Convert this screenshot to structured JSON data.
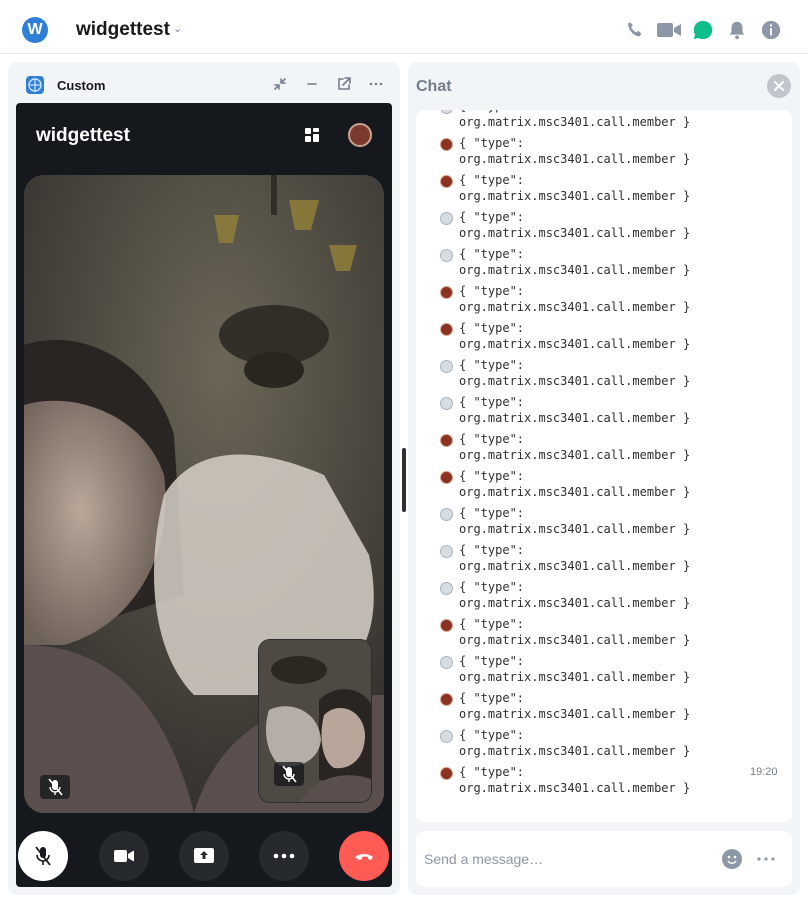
{
  "header": {
    "room_avatar_letter": "W",
    "room_name": "widgettest",
    "room_menu_icon": "chevron-down-icon",
    "icons": [
      "phone-icon",
      "video-icon",
      "threads-icon",
      "bell-icon",
      "info-icon"
    ],
    "accent": "#0dbd8b"
  },
  "widget": {
    "title": "Custom",
    "icons": [
      "widget-icon",
      "minimize-icon",
      "collapse-icon",
      "popout-icon",
      "overflow-icon"
    ]
  },
  "call": {
    "room_title": "widgettest",
    "controls": [
      "microphone-muted-icon",
      "video-icon",
      "screen-share-icon",
      "more-icon",
      "hangup-icon"
    ],
    "hangup_color": "#ff5b55"
  },
  "chat": {
    "title": "Chat",
    "messages": [
      {
        "line1": "{ \"type\":",
        "line2": "org.matrix.msc3401.call.member }",
        "sender": "b"
      },
      {
        "line1": "{ \"type\":",
        "line2": "org.matrix.msc3401.call.member }",
        "sender": "a"
      },
      {
        "line1": "{ \"type\":",
        "line2": "org.matrix.msc3401.call.member }",
        "sender": "a"
      },
      {
        "line1": "{ \"type\":",
        "line2": "org.matrix.msc3401.call.member }",
        "sender": "b"
      },
      {
        "line1": "{ \"type\":",
        "line2": "org.matrix.msc3401.call.member }",
        "sender": "b"
      },
      {
        "line1": "{ \"type\":",
        "line2": "org.matrix.msc3401.call.member }",
        "sender": "a"
      },
      {
        "line1": "{ \"type\":",
        "line2": "org.matrix.msc3401.call.member }",
        "sender": "a"
      },
      {
        "line1": "{ \"type\":",
        "line2": "org.matrix.msc3401.call.member }",
        "sender": "b"
      },
      {
        "line1": "{ \"type\":",
        "line2": "org.matrix.msc3401.call.member }",
        "sender": "b"
      },
      {
        "line1": "{ \"type\":",
        "line2": "org.matrix.msc3401.call.member }",
        "sender": "a"
      },
      {
        "line1": "{ \"type\":",
        "line2": "org.matrix.msc3401.call.member }",
        "sender": "a"
      },
      {
        "line1": "{ \"type\":",
        "line2": "org.matrix.msc3401.call.member }",
        "sender": "b"
      },
      {
        "line1": "{ \"type\":",
        "line2": "org.matrix.msc3401.call.member }",
        "sender": "b"
      },
      {
        "line1": "{ \"type\":",
        "line2": "org.matrix.msc3401.call.member }",
        "sender": "b"
      },
      {
        "line1": "{ \"type\":",
        "line2": "org.matrix.msc3401.call.member }",
        "sender": "a"
      },
      {
        "line1": "{ \"type\":",
        "line2": "org.matrix.msc3401.call.member }",
        "sender": "b"
      },
      {
        "line1": "{ \"type\":",
        "line2": "org.matrix.msc3401.call.member }",
        "sender": "a"
      },
      {
        "line1": "{ \"type\":",
        "line2": "org.matrix.msc3401.call.member }",
        "sender": "b"
      },
      {
        "line1": "{ \"type\":",
        "line2": "org.matrix.msc3401.call.member }",
        "sender": "a"
      }
    ],
    "last_timestamp": "19:20",
    "composer_placeholder": "Send a message…"
  }
}
